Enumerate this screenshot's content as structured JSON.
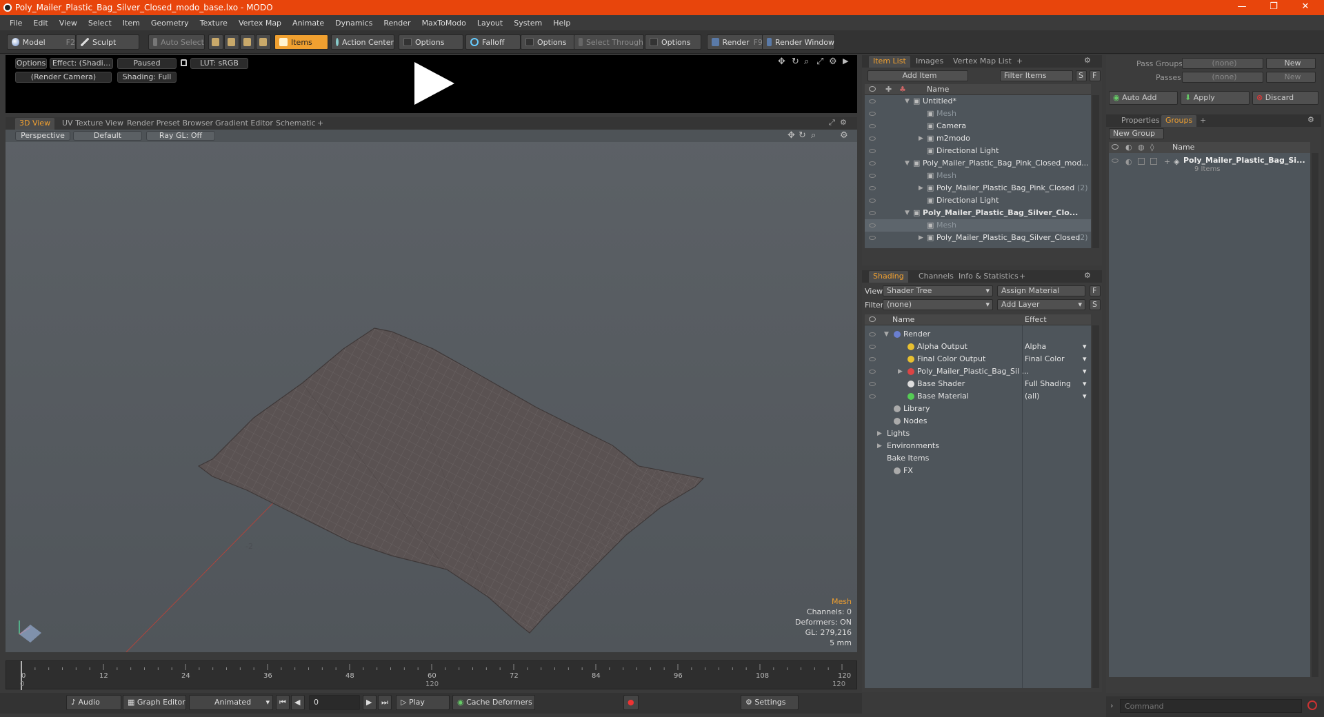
{
  "window": {
    "title": "Poly_Mailer_Plastic_Bag_Silver_Closed_modo_base.lxo - MODO"
  },
  "menu": [
    "File",
    "Edit",
    "View",
    "Select",
    "Item",
    "Geometry",
    "Texture",
    "Vertex Map",
    "Animate",
    "Dynamics",
    "Render",
    "MaxToModo",
    "Layout",
    "System",
    "Help"
  ],
  "toolbar": {
    "model": "Model",
    "model_key": "F2",
    "sculpt": "Sculpt",
    "auto_select": "Auto Select",
    "items": "Items",
    "action_center": "Action Center",
    "options1": "Options",
    "falloff": "Falloff",
    "options2": "Options",
    "select_through": "Select Through",
    "options3": "Options",
    "render": "Render",
    "render_key": "F9",
    "render_window": "Render Window"
  },
  "preview": {
    "options": "Options",
    "effect": "Effect: (Shadi...",
    "paused": "Paused",
    "lut": "LUT: sRGB",
    "camera": "(Render Camera)",
    "shading": "Shading: Full"
  },
  "viewtabs": [
    "3D View",
    "UV Texture View",
    "Render Preset Browser",
    "Gradient Editor",
    "Schematic",
    "+"
  ],
  "viewport": {
    "perspective": "Perspective",
    "default": "Default",
    "raygl": "Ray GL: Off",
    "stats": {
      "title": "Mesh",
      "channels": "Channels: 0",
      "deformers": "Deformers: ON",
      "gl": "GL: 279,216",
      "scale": "5 mm"
    },
    "axis_tick": "-2"
  },
  "timeline": {
    "ticks": [
      "0",
      "12",
      "24",
      "36",
      "48",
      "60",
      "72",
      "84",
      "96",
      "108",
      "120"
    ],
    "start": "0",
    "mid": "120",
    "end": "120"
  },
  "bottombar": {
    "audio": "Audio",
    "graph_editor": "Graph Editor",
    "animated": "Animated",
    "frame": "0",
    "play": "Play",
    "cache_deformers": "Cache Deformers",
    "settings": "Settings"
  },
  "item_list": {
    "tabs": [
      "Item List",
      "Images",
      "Vertex Map List",
      "+"
    ],
    "add_item": "Add Item",
    "filter_items": "Filter Items",
    "s": "S",
    "f": "F",
    "col_name": "Name",
    "rows": [
      {
        "label": "Untitled*",
        "style": ""
      },
      {
        "label": "Mesh",
        "style": "dim"
      },
      {
        "label": "Camera",
        "style": ""
      },
      {
        "label": "m2modo",
        "style": ""
      },
      {
        "label": "Directional Light",
        "style": ""
      },
      {
        "label": "Poly_Mailer_Plastic_Bag_Pink_Closed_mod...",
        "style": ""
      },
      {
        "label": "Mesh",
        "style": "dim"
      },
      {
        "label": "Poly_Mailer_Plastic_Bag_Pink_Closed",
        "count": "(2)",
        "style": ""
      },
      {
        "label": "Directional Light",
        "style": ""
      },
      {
        "label": "Poly_Mailer_Plastic_Bag_Silver_Clo...",
        "style": "bold"
      },
      {
        "label": "Mesh",
        "style": "dim sel"
      },
      {
        "label": "Poly_Mailer_Plastic_Bag_Silver_Closed",
        "count": "(2)",
        "style": ""
      }
    ]
  },
  "shading": {
    "tabs": [
      "Shading",
      "Channels",
      "Info & Statistics",
      "+"
    ],
    "view_label": "View",
    "view_value": "Shader Tree",
    "assign_material": "Assign Material",
    "f": "F",
    "filter_label": "Filter",
    "filter_value": "(none)",
    "add_layer": "Add Layer",
    "s": "S",
    "col_name": "Name",
    "col_effect": "Effect",
    "rows": [
      {
        "label": "Render",
        "effect": ""
      },
      {
        "label": "Alpha Output",
        "effect": "Alpha"
      },
      {
        "label": "Final Color Output",
        "effect": "Final Color"
      },
      {
        "label": "Poly_Mailer_Plastic_Bag_Sil ...",
        "effect": ""
      },
      {
        "label": "Base Shader",
        "effect": "Full Shading"
      },
      {
        "label": "Base Material",
        "effect": "(all)"
      },
      {
        "label": "Library",
        "effect": ""
      },
      {
        "label": "Nodes",
        "effect": ""
      },
      {
        "label": "Lights",
        "effect": ""
      },
      {
        "label": "Environments",
        "effect": ""
      },
      {
        "label": "Bake Items",
        "effect": ""
      },
      {
        "label": "FX",
        "effect": ""
      }
    ]
  },
  "groups_panel": {
    "pass_groups_label": "Pass Groups",
    "pass_groups_value": "(none)",
    "new1": "New",
    "passes_label": "Passes",
    "passes_value": "(none)",
    "new2": "New",
    "auto_add": "Auto Add",
    "apply": "Apply",
    "discard": "Discard",
    "tabs": [
      "Properties",
      "Groups",
      "+"
    ],
    "new_group": "New Group",
    "col_name": "Name",
    "group_name": "Poly_Mailer_Plastic_Bag_Si...",
    "group_count": "9 Items"
  },
  "command": {
    "placeholder": "Command"
  },
  "colors": {
    "accent": "#f0a030",
    "titlebar": "#e8450c"
  }
}
